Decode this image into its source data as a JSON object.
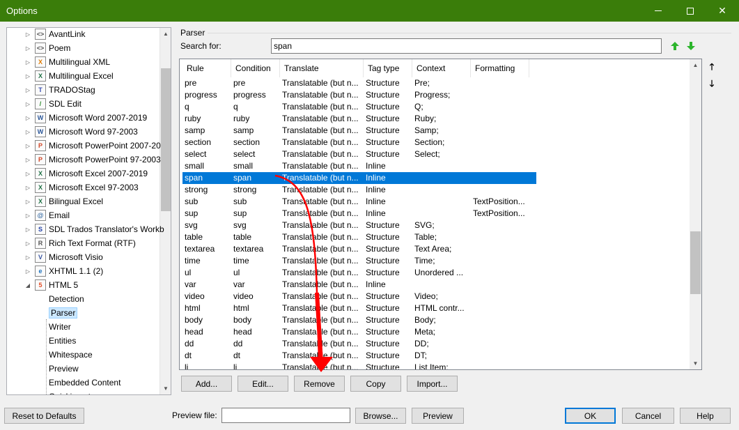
{
  "window": {
    "title": "Options"
  },
  "tree": {
    "items": [
      {
        "label": "AvantLink",
        "icon": "avantlink-file-icon",
        "glyph": "<>",
        "color": "#555555",
        "expander": true
      },
      {
        "label": "Poem",
        "icon": "poem-file-icon",
        "glyph": "<>",
        "color": "#555555",
        "expander": true
      },
      {
        "label": "Multilingual XML",
        "icon": "multilingual-xml-icon",
        "glyph": "X",
        "color": "#e07b00",
        "expander": true
      },
      {
        "label": "Multilingual Excel",
        "icon": "multilingual-excel-icon",
        "glyph": "X",
        "color": "#1d7044",
        "expander": true
      },
      {
        "label": "TRADOStag",
        "icon": "tradostag-icon",
        "glyph": "T",
        "color": "#3a4fb0",
        "expander": true
      },
      {
        "label": "SDL Edit",
        "icon": "sdl-edit-icon",
        "glyph": "/",
        "color": "#2a8a2a",
        "expander": true
      },
      {
        "label": "Microsoft Word 2007-2019",
        "icon": "word-icon",
        "glyph": "W",
        "color": "#2b579a",
        "expander": true
      },
      {
        "label": "Microsoft Word 97-2003",
        "icon": "word-97-icon",
        "glyph": "W",
        "color": "#2b579a",
        "expander": true
      },
      {
        "label": "Microsoft PowerPoint 2007-20",
        "icon": "powerpoint-icon",
        "glyph": "P",
        "color": "#d24726",
        "expander": true
      },
      {
        "label": "Microsoft PowerPoint 97-2003",
        "icon": "powerpoint-97-icon",
        "glyph": "P",
        "color": "#d24726",
        "expander": true
      },
      {
        "label": "Microsoft Excel 2007-2019",
        "icon": "excel-icon",
        "glyph": "X",
        "color": "#1d7044",
        "expander": true
      },
      {
        "label": "Microsoft Excel 97-2003",
        "icon": "excel-97-icon",
        "glyph": "X",
        "color": "#1d7044",
        "expander": true
      },
      {
        "label": "Bilingual Excel",
        "icon": "bilingual-excel-icon",
        "glyph": "X",
        "color": "#1d7044",
        "expander": true
      },
      {
        "label": "Email",
        "icon": "email-icon",
        "glyph": "@",
        "color": "#3a6ea5",
        "expander": true
      },
      {
        "label": "SDL Trados Translator's Workb",
        "icon": "trados-workbench-icon",
        "glyph": "S",
        "color": "#1f3fa6",
        "expander": true
      },
      {
        "label": "Rich Text Format (RTF)",
        "icon": "rtf-icon",
        "glyph": "R",
        "color": "#555555",
        "expander": true
      },
      {
        "label": "Microsoft Visio",
        "icon": "visio-icon",
        "glyph": "V",
        "color": "#3955a3",
        "expander": true
      },
      {
        "label": "XHTML 1.1 (2)",
        "icon": "xhtml-icon",
        "glyph": "e",
        "color": "#1e73be",
        "expander": true
      },
      {
        "label": "HTML 5",
        "icon": "html5-icon",
        "glyph": "5",
        "color": "#e44d26",
        "expander": true,
        "expanded": true
      },
      {
        "label": "Detection",
        "child": true
      },
      {
        "label": "Parser",
        "child": true,
        "selected": true
      },
      {
        "label": "Writer",
        "child": true
      },
      {
        "label": "Entities",
        "child": true
      },
      {
        "label": "Whitespace",
        "child": true
      },
      {
        "label": "Preview",
        "child": true
      },
      {
        "label": "Embedded Content",
        "child": true
      },
      {
        "label": "Quickinsert",
        "child": true
      }
    ]
  },
  "parser": {
    "group_label": "Parser",
    "search_label": "Search for:",
    "search_value": "span",
    "columns": [
      "Rule",
      "Condition",
      "Translate",
      "Tag type",
      "Context",
      "Formatting"
    ],
    "rows": [
      [
        "pre",
        "pre",
        "Translatable (but n...",
        "Structure",
        "Pre;",
        ""
      ],
      [
        "progress",
        "progress",
        "Translatable (but n...",
        "Structure",
        "Progress;",
        ""
      ],
      [
        "q",
        "q",
        "Translatable (but n...",
        "Structure",
        "Q;",
        ""
      ],
      [
        "ruby",
        "ruby",
        "Translatable (but n...",
        "Structure",
        "Ruby;",
        ""
      ],
      [
        "samp",
        "samp",
        "Translatable (but n...",
        "Structure",
        "Samp;",
        ""
      ],
      [
        "section",
        "section",
        "Translatable (but n...",
        "Structure",
        "Section;",
        ""
      ],
      [
        "select",
        "select",
        "Translatable (but n...",
        "Structure",
        "Select;",
        ""
      ],
      [
        "small",
        "small",
        "Translatable (but n...",
        "Inline",
        "",
        ""
      ],
      [
        "span",
        "span",
        "Translatable (but n...",
        "Inline",
        "",
        ""
      ],
      [
        "strong",
        "strong",
        "Translatable (but n...",
        "Inline",
        "",
        ""
      ],
      [
        "sub",
        "sub",
        "Translatable (but n...",
        "Inline",
        "",
        "TextPosition..."
      ],
      [
        "sup",
        "sup",
        "Translatable (but n...",
        "Inline",
        "",
        "TextPosition..."
      ],
      [
        "svg",
        "svg",
        "Translatable (but n...",
        "Structure",
        "SVG;",
        ""
      ],
      [
        "table",
        "table",
        "Translatable (but n...",
        "Structure",
        "Table;",
        ""
      ],
      [
        "textarea",
        "textarea",
        "Translatable (but n...",
        "Structure",
        "Text Area;",
        ""
      ],
      [
        "time",
        "time",
        "Translatable (but n...",
        "Structure",
        "Time;",
        ""
      ],
      [
        "ul",
        "ul",
        "Translatable (but n...",
        "Structure",
        "Unordered ...",
        ""
      ],
      [
        "var",
        "var",
        "Translatable (but n...",
        "Inline",
        "",
        ""
      ],
      [
        "video",
        "video",
        "Translatable (but n...",
        "Structure",
        "Video;",
        ""
      ],
      [
        "html",
        "html",
        "Translatable (but n...",
        "Structure",
        "HTML contr...",
        ""
      ],
      [
        "body",
        "body",
        "Translatable (but n...",
        "Structure",
        "Body;",
        ""
      ],
      [
        "head",
        "head",
        "Translatable (but n...",
        "Structure",
        "Meta;",
        ""
      ],
      [
        "dd",
        "dd",
        "Translatable (but n...",
        "Structure",
        "DD;",
        ""
      ],
      [
        "dt",
        "dt",
        "Translatable (but n...",
        "Structure",
        "DT;",
        ""
      ],
      [
        "li",
        "li",
        "Translatable (but n...",
        "Structure",
        "List Item;",
        ""
      ]
    ],
    "selected_row": 8,
    "buttons": {
      "add": "Add...",
      "edit": "Edit...",
      "remove": "Remove",
      "copy": "Copy",
      "import": "Import..."
    }
  },
  "footer": {
    "reset": "Reset to Defaults",
    "preview_label": "Preview file:",
    "preview_value": "",
    "browse": "Browse...",
    "preview": "Preview",
    "ok": "OK",
    "cancel": "Cancel",
    "help": "Help"
  },
  "colors": {
    "titlebar": "#3a7d0a",
    "selection": "#0078d7",
    "annotation_arrow": "#ff0000",
    "find_next_arrow": "#2cb52c"
  }
}
